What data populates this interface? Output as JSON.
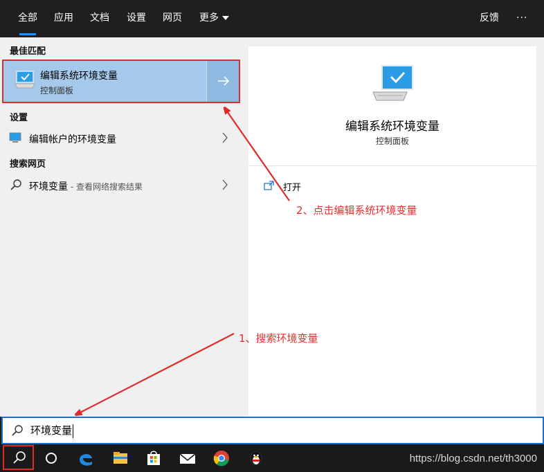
{
  "tabs": [
    {
      "label": "全部"
    },
    {
      "label": "应用"
    },
    {
      "label": "文档"
    },
    {
      "label": "设置"
    },
    {
      "label": "网页"
    },
    {
      "label": "更多"
    }
  ],
  "header_right": {
    "feedback": "反馈",
    "more": "···"
  },
  "sections": {
    "best_match": "最佳匹配",
    "settings": "设置",
    "web": "搜索网页"
  },
  "best_match": {
    "title": "编辑系统环境变量",
    "subtitle": "控制面板"
  },
  "settings_item": {
    "label": "编辑帐户的环境变量"
  },
  "web_item": {
    "label": "环境变量",
    "suffix": " - 查看网络搜索结果"
  },
  "details": {
    "title": "编辑系统环境变量",
    "subtitle": "控制面板",
    "action_open": "打开"
  },
  "search": {
    "value": "环境变量"
  },
  "annotations": {
    "step1": "1、搜索环境变量",
    "step2": "2、点击编辑系统环境变量"
  },
  "watermark": "https://blog.csdn.net/th3000",
  "colors": {
    "accent": "#1e90ff",
    "annotation_red": "#e02b2b",
    "selected_bg": "#a4c9ea"
  }
}
